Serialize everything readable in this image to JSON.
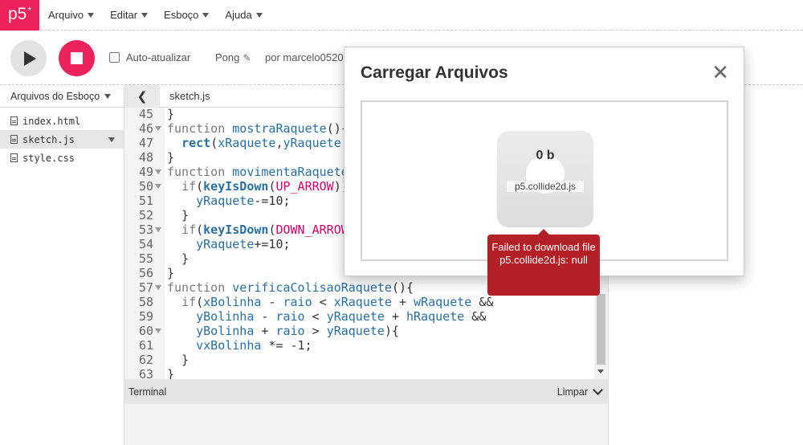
{
  "nav": {
    "logo": "p5",
    "logo_sup": "*",
    "menu": [
      {
        "label": "Arquivo"
      },
      {
        "label": "Editar"
      },
      {
        "label": "Esboço"
      },
      {
        "label": "Ajuda"
      }
    ]
  },
  "toolbar": {
    "auto_refresh_label": "Auto-atualizar",
    "auto_refresh_checked": false,
    "project_name": "Pong",
    "author": "por marcelo0520"
  },
  "sidebar": {
    "header": "Arquivos do Esboço",
    "files": [
      {
        "name": "index.html",
        "selected": false
      },
      {
        "name": "sketch.js",
        "selected": true
      },
      {
        "name": "style.css",
        "selected": false
      }
    ]
  },
  "editor": {
    "tab_name": "sketch.js",
    "lines": [
      {
        "n": "45",
        "fold": false,
        "text": "}"
      },
      {
        "n": "46",
        "fold": true,
        "text": "function mostraRaquete(){"
      },
      {
        "n": "47",
        "fold": false,
        "text": "  rect(xRaquete,yRaquete"
      },
      {
        "n": "48",
        "fold": false,
        "text": "}"
      },
      {
        "n": "49",
        "fold": true,
        "text": "function movimentaRaquete"
      },
      {
        "n": "50",
        "fold": true,
        "text": "  if(keyIsDown(UP_ARROW))"
      },
      {
        "n": "51",
        "fold": false,
        "text": "    yRaquete-=10;"
      },
      {
        "n": "52",
        "fold": false,
        "text": "  }"
      },
      {
        "n": "53",
        "fold": true,
        "text": "  if(keyIsDown(DOWN_ARROW"
      },
      {
        "n": "54",
        "fold": false,
        "text": "    yRaquete+=10;"
      },
      {
        "n": "55",
        "fold": false,
        "text": "  }"
      },
      {
        "n": "56",
        "fold": false,
        "text": "}"
      },
      {
        "n": "57",
        "fold": true,
        "text": "function verificaColisaoRaquete(){"
      },
      {
        "n": "58",
        "fold": false,
        "text": "  if(xBolinha - raio < xRaquete + wRaquete &&"
      },
      {
        "n": "59",
        "fold": false,
        "text": "    yBolinha - raio < yRaquete + hRaquete &&"
      },
      {
        "n": "60",
        "fold": true,
        "text": "    yBolinha + raio > yRaquete){"
      },
      {
        "n": "61",
        "fold": false,
        "text": "    vxBolinha *= -1;"
      },
      {
        "n": "62",
        "fold": false,
        "text": "  }"
      },
      {
        "n": "63",
        "fold": false,
        "text": "}"
      }
    ]
  },
  "console": {
    "title": "Terminal",
    "clear_label": "Limpar"
  },
  "modal": {
    "title": "Carregar Arquivos",
    "close_icon": "close-icon",
    "file_size": "0 b",
    "file_name": "p5.collide2d.js",
    "error_message": "Failed to download file p5.collide2d.js: null"
  },
  "colors": {
    "brand": "#ed225d",
    "error": "#b32026"
  }
}
